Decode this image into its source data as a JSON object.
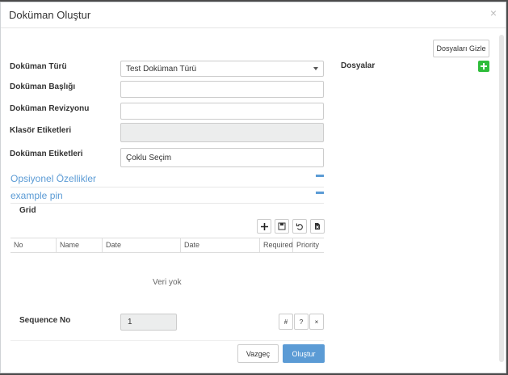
{
  "modal": {
    "title": "Doküman Oluştur",
    "close": "×"
  },
  "files": {
    "hide_button": "Dosyaları Gizle",
    "label": "Dosyalar"
  },
  "form": {
    "doc_type_label": "Doküman Türü",
    "doc_type_value": "Test Doküman Türü",
    "doc_title_label": "Doküman Başlığı",
    "doc_title_value": "",
    "doc_revision_label": "Doküman Revizyonu",
    "doc_revision_value": "",
    "folder_tags_label": "Klasör Etiketleri",
    "doc_tags_label": "Doküman Etiketleri",
    "doc_tags_value": "Çoklu Seçim"
  },
  "sections": {
    "optional": "Opsiyonel Özellikler",
    "example": "example pin"
  },
  "grid": {
    "label": "Grid",
    "columns": [
      "No",
      "Name",
      "Date",
      "Date",
      "Required",
      "Priority"
    ],
    "empty_text": "Veri yok"
  },
  "sequence": {
    "label": "Sequence No",
    "value": "1"
  },
  "pager": {
    "hash": "#",
    "question": "?",
    "clear": "×"
  },
  "footer": {
    "cancel": "Vazgeç",
    "create": "Oluştur"
  },
  "colors": {
    "accent": "#5b9bd5",
    "add_green": "#2ebd3a"
  }
}
